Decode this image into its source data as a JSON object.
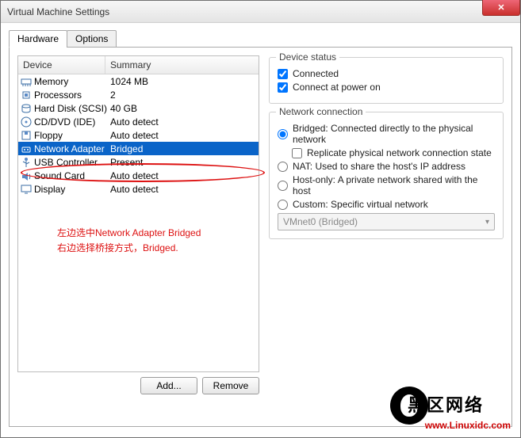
{
  "window": {
    "title": "Virtual Machine Settings"
  },
  "tabs": {
    "hardware": "Hardware",
    "options": "Options"
  },
  "device_header": {
    "device": "Device",
    "summary": "Summary"
  },
  "devices": [
    {
      "name": "Memory",
      "summary": "1024 MB",
      "icon": "memory-icon"
    },
    {
      "name": "Processors",
      "summary": "2",
      "icon": "cpu-icon"
    },
    {
      "name": "Hard Disk (SCSI)",
      "summary": "40 GB",
      "icon": "hdd-icon"
    },
    {
      "name": "CD/DVD (IDE)",
      "summary": "Auto detect",
      "icon": "cd-icon"
    },
    {
      "name": "Floppy",
      "summary": "Auto detect",
      "icon": "floppy-icon"
    },
    {
      "name": "Network Adapter",
      "summary": "Bridged",
      "icon": "net-icon",
      "selected": true
    },
    {
      "name": "USB Controller",
      "summary": "Present",
      "icon": "usb-icon"
    },
    {
      "name": "Sound Card",
      "summary": "Auto detect",
      "icon": "sound-icon"
    },
    {
      "name": "Display",
      "summary": "Auto detect",
      "icon": "display-icon"
    }
  ],
  "buttons": {
    "add": "Add...",
    "remove": "Remove"
  },
  "device_status": {
    "title": "Device status",
    "connected": "Connected",
    "connect_power": "Connect at power on"
  },
  "network_connection": {
    "title": "Network connection",
    "bridged": "Bridged: Connected directly to the physical network",
    "replicate": "Replicate physical network connection state",
    "nat": "NAT: Used to share the host's IP address",
    "hostonly": "Host-only: A private network shared with the host",
    "custom": "Custom: Specific virtual network",
    "combo": "VMnet0 (Bridged)"
  },
  "annotation": {
    "line1": "左边选中Network Adapter Bridged",
    "line2": "右边选择桥接方式，Bridged."
  },
  "watermark": {
    "big": "黑区网络",
    "small": "www.Linuxidc.com"
  }
}
